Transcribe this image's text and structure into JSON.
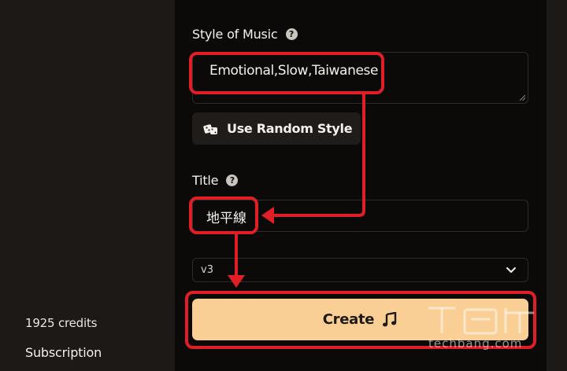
{
  "sidebar": {
    "credits": "1925 credits",
    "subscription": "Subscription"
  },
  "form": {
    "style_label": "Style of Music",
    "style_value": "Emotional,Slow,Taiwanese",
    "random_style_button": "Use Random Style",
    "title_label": "Title",
    "title_value": "地平線",
    "model_select_value": "v3",
    "create_button": "Create"
  },
  "watermark": {
    "text": "techbang.com"
  },
  "icons": {
    "help": "question-circle-icon",
    "dice": "dice-icon",
    "chevron": "chevron-down-icon",
    "music": "music-note-icon"
  },
  "colors": {
    "background": "#0c0a09",
    "sidebar": "#1c1917",
    "create_button": "#f9cf95",
    "annotation": "#e01e26"
  }
}
